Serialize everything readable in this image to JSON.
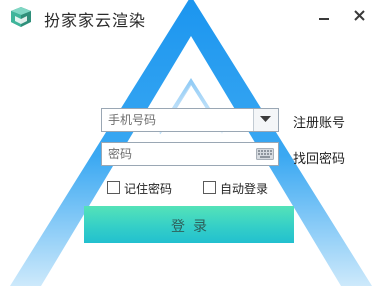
{
  "app": {
    "title": "扮家家云渲染",
    "logo_icon": "cube-logo-icon"
  },
  "window_controls": {
    "minimize_icon": "minimize-icon",
    "close_icon": "close-icon"
  },
  "login_form": {
    "phone_placeholder": "手机号码",
    "phone_value": "",
    "password_placeholder": "密码",
    "password_value": "",
    "dropdown_icon": "chevron-down-icon",
    "keyboard_icon": "keyboard-icon",
    "register_link": "注册账号",
    "recover_link": "找回密码",
    "remember_label": "记住密码",
    "remember_checked": false,
    "autologin_label": "自动登录",
    "autologin_checked": false,
    "login_button": "登录"
  },
  "colors": {
    "accent_blue": "#1e9ff2",
    "button_top": "#55e3b8",
    "button_bottom": "#22c0cf"
  }
}
